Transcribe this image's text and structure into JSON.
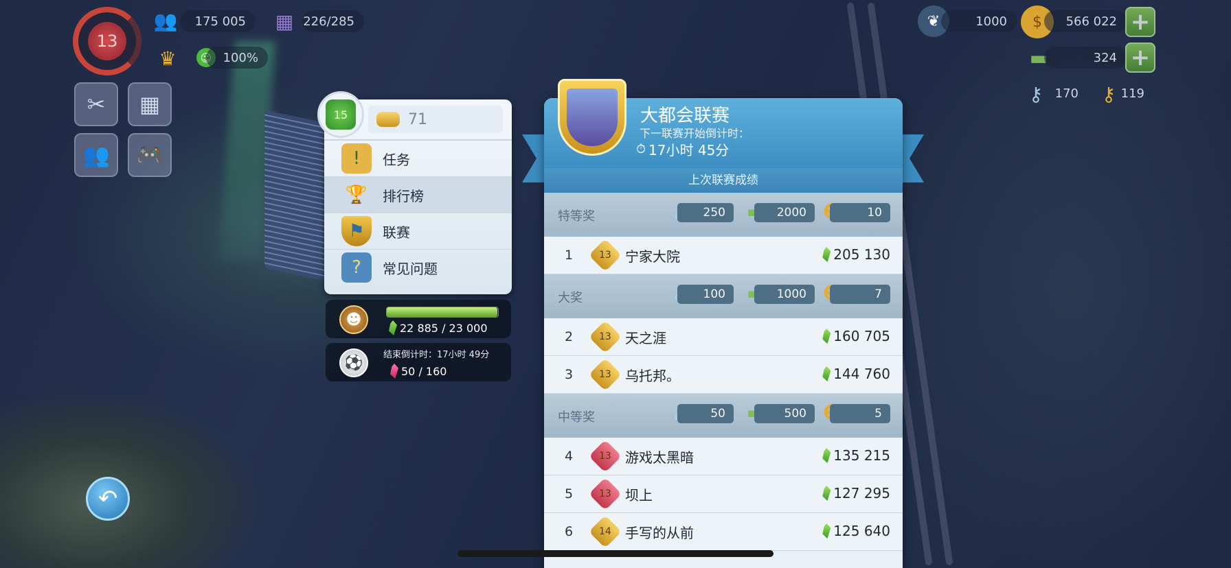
{
  "hud": {
    "player_level": "13",
    "population": "175 005",
    "storage": "226/285",
    "happiness": "100%",
    "neosimoleons": "1000",
    "simoleons": "566 022",
    "simcash": "324",
    "golden_keys_silver": "170",
    "golden_keys": "119"
  },
  "menu": {
    "club_level": "15",
    "gold_amount": "71",
    "items": [
      {
        "label": "任务",
        "icon": "task-icon"
      },
      {
        "label": "排行榜",
        "icon": "trophy-icon"
      },
      {
        "label": "联赛",
        "icon": "league-shield-icon"
      },
      {
        "label": "常见问题",
        "icon": "faq-book-icon"
      }
    ]
  },
  "vu_card": {
    "progress": "22 885 / 23 000",
    "fill_fraction": 0.995
  },
  "event_card": {
    "countdown": "结束倒计时：17小时 49分",
    "progress": "50 / 160"
  },
  "league": {
    "title": "大都会联赛",
    "subtitle": "下一联赛开始倒计时：",
    "timer": "17小时 45分",
    "section_title": "上次联赛成绩",
    "tiers": [
      {
        "name": "特等奖",
        "keys": "250",
        "cash": "2000",
        "medals": "10",
        "rows": [
          {
            "rank": "1",
            "level": "13",
            "name": "宁家大院",
            "score": "205 130",
            "badge": "gold"
          }
        ]
      },
      {
        "name": "大奖",
        "keys": "100",
        "cash": "1000",
        "medals": "7",
        "rows": [
          {
            "rank": "2",
            "level": "13",
            "name": "天之涯",
            "score": "160 705",
            "badge": "gold"
          },
          {
            "rank": "3",
            "level": "13",
            "name": "乌托邦。",
            "score": "144 760",
            "badge": "gold"
          }
        ]
      },
      {
        "name": "中等奖",
        "keys": "50",
        "cash": "500",
        "medals": "5",
        "rows": [
          {
            "rank": "4",
            "level": "13",
            "name": "游戏太黑暗",
            "score": "135 215",
            "badge": "red"
          },
          {
            "rank": "5",
            "level": "13",
            "name": "坝上",
            "score": "127 295",
            "badge": "red"
          },
          {
            "rank": "6",
            "level": "14",
            "name": "手写的从前",
            "score": "125 640",
            "badge": "gold"
          }
        ]
      }
    ]
  },
  "colors": {
    "accent_blue": "#3c8ec3",
    "gold": "#e0b03a",
    "red_badge": "#d9566a"
  }
}
